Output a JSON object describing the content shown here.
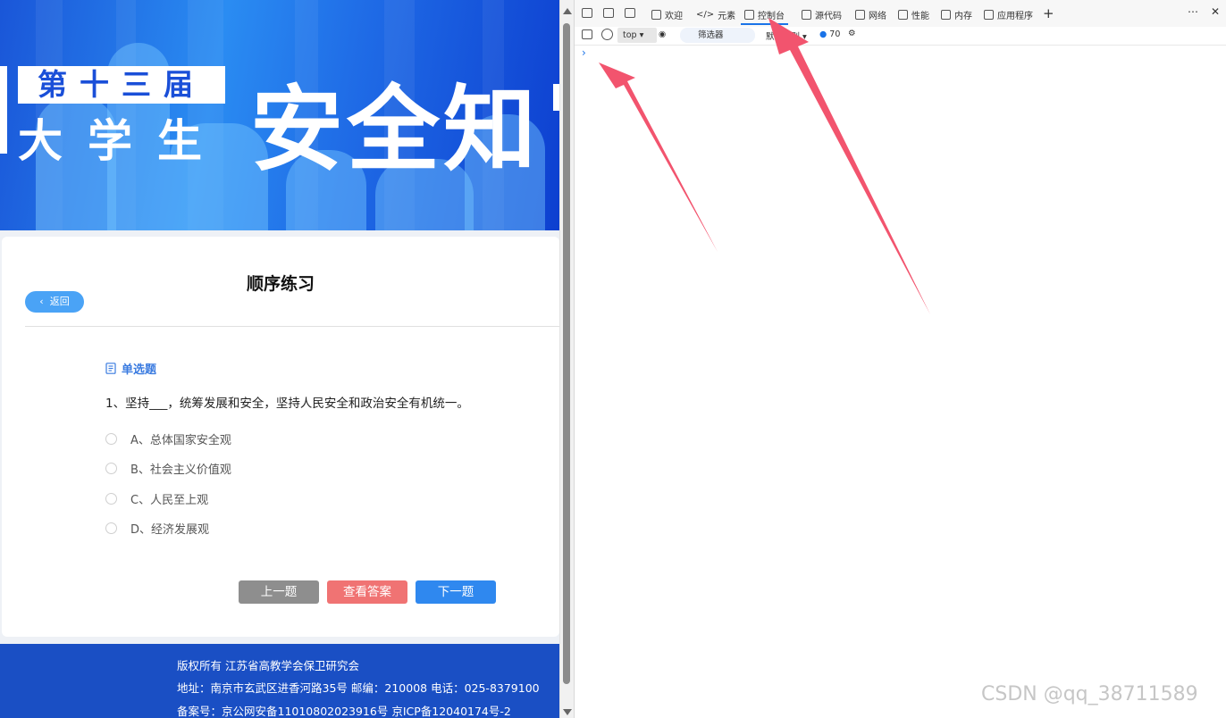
{
  "banner": {
    "line1": "第十三届",
    "line2": "大学生",
    "line3": "安全知"
  },
  "page": {
    "title": "顺序练习",
    "back_label": "返回",
    "question_type": "单选题",
    "question": "1、坚持___，统筹发展和安全，坚持人民安全和政治安全有机统一。",
    "options": [
      "A、总体国家安全观",
      "B、社会主义价值观",
      "C、人民至上观",
      "D、经济发展观"
    ],
    "buttons": {
      "prev": "上一题",
      "answer": "查看答案",
      "next": "下一题"
    }
  },
  "footer": {
    "copyright": "版权所有 江苏省高教学会保卫研究会",
    "address": "地址：南京市玄武区进香河路35号     邮编：210008     电话：025-8379100",
    "icp": "备案号：京公网安备11010802023916号 京ICP备12040174号-2"
  },
  "devtools": {
    "tabs": [
      "欢迎",
      "元素",
      "控制台",
      "源代码",
      "网络",
      "性能",
      "内存",
      "应用程序"
    ],
    "active_tab": "控制台",
    "context": "top",
    "filter_placeholder": "筛选器",
    "levels_label": "默认级别",
    "message_count": "70",
    "prompt": "›",
    "accent_color": "#1a73e8"
  },
  "watermark": "CSDN @qq_38711589",
  "colors": {
    "banner": "#1f6be6",
    "footer": "#1a4fc4",
    "prev_button": "#8e8e8e",
    "answer_button": "#f07373",
    "next_button": "#2f88ef",
    "annotation_arrow": "#f2546e"
  }
}
